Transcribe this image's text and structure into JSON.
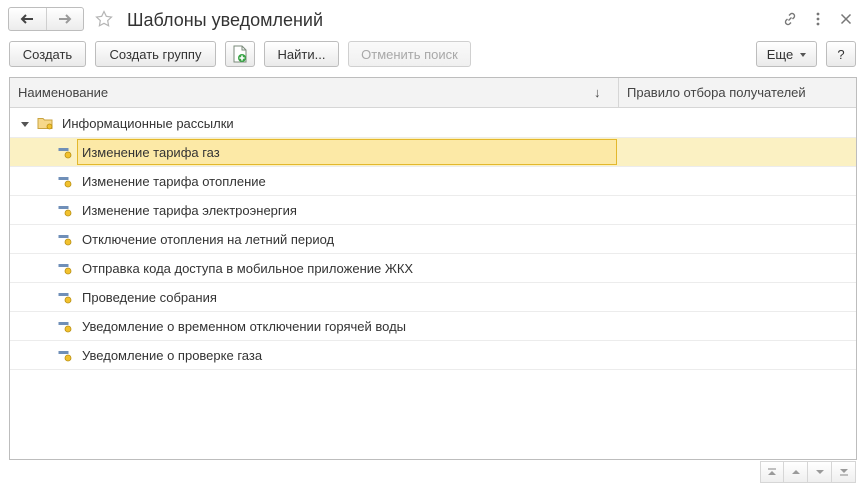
{
  "window": {
    "title": "Шаблоны уведомлений"
  },
  "toolbar": {
    "create_label": "Создать",
    "create_group_label": "Создать группу",
    "find_label": "Найти...",
    "cancel_search_label": "Отменить поиск",
    "more_label": "Еще",
    "help_label": "?"
  },
  "table": {
    "columns": {
      "name": "Наименование",
      "rule": "Правило отбора получателей"
    },
    "group": {
      "label": "Информационные рассылки"
    },
    "rows": [
      {
        "name": "Изменение тарифа газ",
        "rule": ""
      },
      {
        "name": "Изменение тарифа отопление",
        "rule": ""
      },
      {
        "name": "Изменение тарифа электроэнергия",
        "rule": ""
      },
      {
        "name": "Отключение отопления на летний период",
        "rule": ""
      },
      {
        "name": "Отправка кода доступа в мобильное приложение ЖКХ",
        "rule": ""
      },
      {
        "name": "Проведение собрания",
        "rule": ""
      },
      {
        "name": "Уведомление о временном отключении горячей воды",
        "rule": ""
      },
      {
        "name": "Уведомление о проверке газа",
        "rule": ""
      }
    ],
    "selected_row": "Изменение тарифа газ"
  },
  "icons": {
    "back": "arrow-left-icon",
    "forward": "arrow-right-icon",
    "favorite": "star-icon",
    "link": "link-icon",
    "menu": "more-dots-icon",
    "close": "close-icon",
    "copy": "copy-document-icon",
    "folder": "folder-icon",
    "item": "template-item-icon",
    "sort": "sort-down-icon"
  },
  "colors": {
    "selection_background": "#fbf1c3",
    "focus_border": "#e3b82d",
    "focus_fill": "#fce9a6",
    "header_background": "#f3f3f3",
    "border": "#bdbdbd"
  }
}
